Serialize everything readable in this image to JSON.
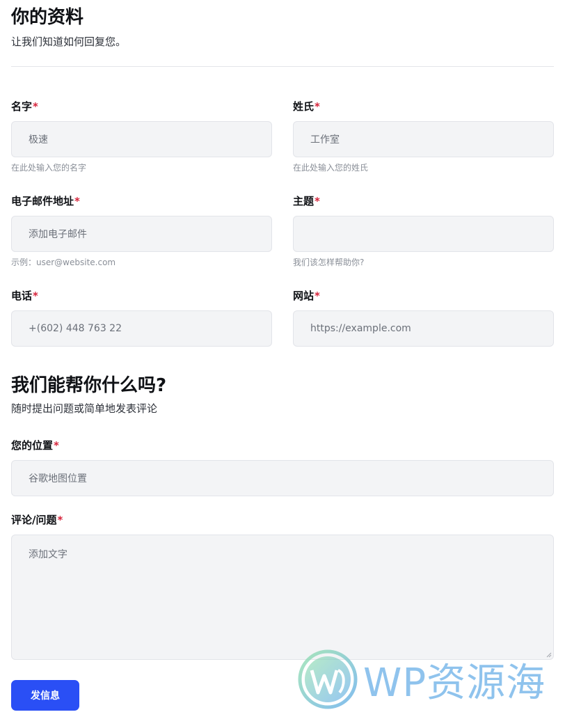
{
  "profile": {
    "title": "你的资料",
    "description": "让我们知道如何回复您。"
  },
  "fields": {
    "first_name": {
      "label": "名字",
      "required_mark": "*",
      "value": "极速",
      "help": "在此处输入您的名字"
    },
    "last_name": {
      "label": "姓氏",
      "required_mark": "*",
      "value": "工作室",
      "help": "在此处输入您的姓氏"
    },
    "email": {
      "label": "电子邮件地址",
      "required_mark": "*",
      "placeholder": "添加电子邮件",
      "help": "示例：user@website.com"
    },
    "subject": {
      "label": "主题",
      "required_mark": "*",
      "value": "",
      "help": "我们该怎样帮助你?"
    },
    "phone": {
      "label": "电话",
      "required_mark": "*",
      "placeholder": "+(602) 448 763 22"
    },
    "website": {
      "label": "网站",
      "required_mark": "*",
      "placeholder": "https://example.com"
    },
    "location": {
      "label": "您的位置",
      "required_mark": "*",
      "placeholder": "谷歌地图位置"
    },
    "comment": {
      "label": "评论/问题",
      "required_mark": "*",
      "placeholder": "添加文字"
    }
  },
  "help_section": {
    "title": "我们能帮你什么吗?",
    "description": "随时提出问题或简单地发表评论"
  },
  "submit": {
    "label": "发信息"
  },
  "watermark": {
    "text": "WP资源海",
    "icon": "wordpress-logo-icon"
  },
  "colors": {
    "accent": "#2a4ff5",
    "required": "#d6243b",
    "input_bg": "#f3f4f6"
  }
}
